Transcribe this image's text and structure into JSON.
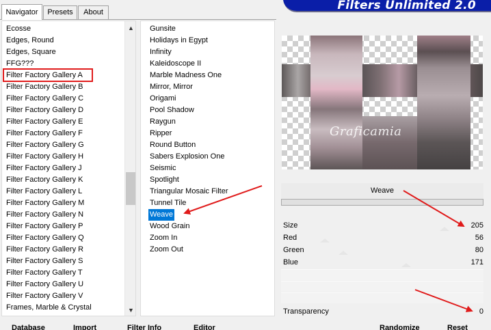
{
  "tabs": [
    "Navigator",
    "Presets",
    "About"
  ],
  "banner_title": "Filters Unlimited 2.0",
  "categories": [
    "Ecosse",
    "Edges, Round",
    "Edges, Square",
    "FFG???",
    "Filter Factory Gallery A",
    "Filter Factory Gallery B",
    "Filter Factory Gallery C",
    "Filter Factory Gallery D",
    "Filter Factory Gallery E",
    "Filter Factory Gallery F",
    "Filter Factory Gallery G",
    "Filter Factory Gallery H",
    "Filter Factory Gallery J",
    "Filter Factory Gallery K",
    "Filter Factory Gallery L",
    "Filter Factory Gallery M",
    "Filter Factory Gallery N",
    "Filter Factory Gallery P",
    "Filter Factory Gallery Q",
    "Filter Factory Gallery R",
    "Filter Factory Gallery S",
    "Filter Factory Gallery T",
    "Filter Factory Gallery U",
    "Filter Factory Gallery V",
    "Frames, Marble & Crystal"
  ],
  "highlighted_category": "Filter Factory Gallery A",
  "filters": [
    "Gunsite",
    "Holidays in Egypt",
    "Infinity",
    "Kaleidoscope II",
    "Marble Madness One",
    "Mirror, Mirror",
    "Origami",
    "Pool Shadow",
    "Raygun",
    "Ripper",
    "Round Button",
    "Sabers Explosion One",
    "Seismic",
    "Spotlight",
    "Triangular Mosaic Filter",
    "Tunnel Tile",
    "Weave",
    "Wood Grain",
    "Zoom In",
    "Zoom Out"
  ],
  "selected_filter": "Weave",
  "watermark": "Graficamia",
  "filter_name": "Weave",
  "params": [
    {
      "label": "Size",
      "value": "205"
    },
    {
      "label": "Red",
      "value": "56"
    },
    {
      "label": "Green",
      "value": "80"
    },
    {
      "label": "Blue",
      "value": "171"
    }
  ],
  "transparency": {
    "label": "Transparency",
    "value": "0"
  },
  "buttons": {
    "database": "Database",
    "import": "Import",
    "filter_info": "Filter Info",
    "editor": "Editor",
    "randomize": "Randomize",
    "reset": "Reset"
  },
  "scroll_icons": {
    "up": "▲",
    "down": "▼"
  },
  "colors": {
    "selection": "#0078d7",
    "highlight_box": "#e01b1b",
    "banner": "#0a1ea8",
    "arrow": "#e01b1b"
  }
}
